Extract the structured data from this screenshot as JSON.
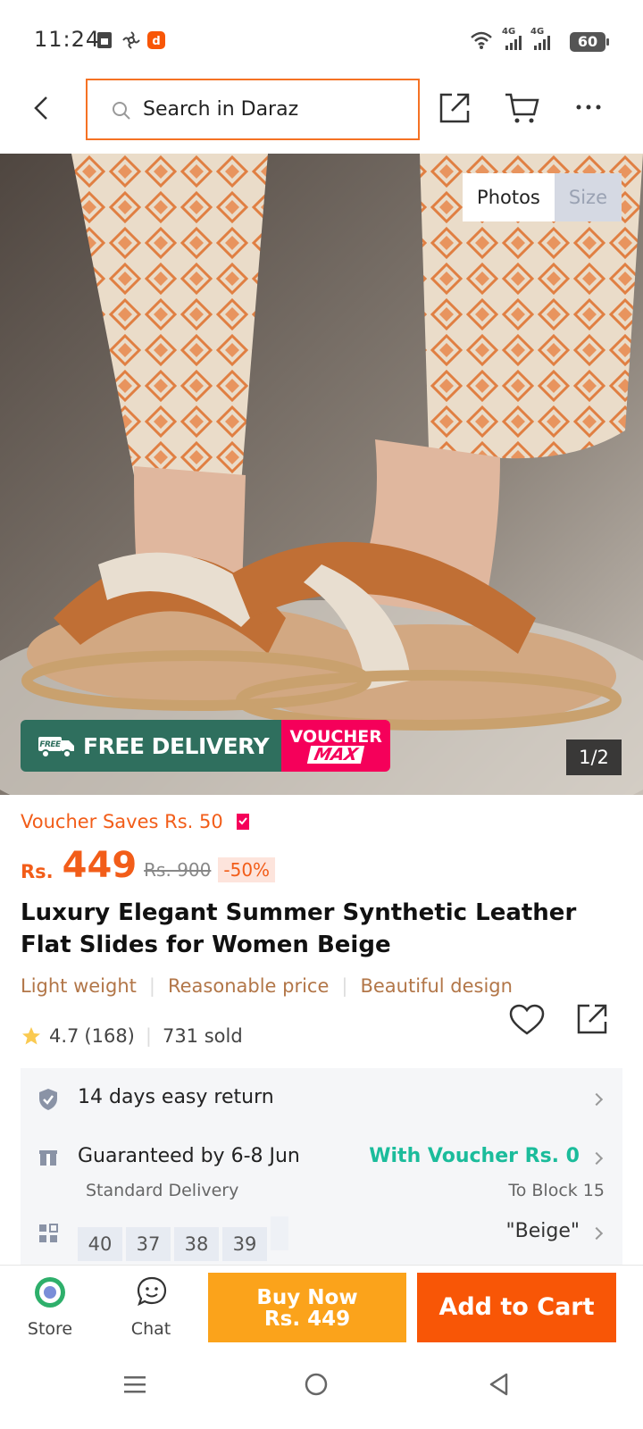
{
  "status_bar": {
    "time": "11:24",
    "network1": "4G",
    "network2": "4G",
    "battery": "60"
  },
  "header": {
    "search_placeholder": "Search in Daraz"
  },
  "gallery": {
    "tabs": [
      "Photos",
      "Size"
    ],
    "active_tab": "Photos",
    "pager": "1/2",
    "promo_free_small": "FREE",
    "promo_free_delivery": "FREE DELIVERY",
    "promo_voucher": "VOUCHER",
    "promo_max": "MAX"
  },
  "product": {
    "voucher_saves": "Voucher Saves Rs. 50",
    "currency": "Rs.",
    "price": "449",
    "original_price": "Rs. 900",
    "discount": "-50%",
    "title": "Luxury Elegant Summer Synthetic Leather Flat Slides for Women Beige",
    "tags": [
      "Light weight",
      "Reasonable price",
      "Beautiful design"
    ],
    "rating": "4.7",
    "rating_count": "(168)",
    "sold": "731 sold"
  },
  "services": {
    "return": "14 days easy return",
    "delivery_guarantee": "Guaranteed by 6-8 Jun",
    "delivery_type": "Standard Delivery",
    "voucher_fee": "With Voucher Rs. 0",
    "location": "To Block 15",
    "sizes": [
      "40",
      "37",
      "38",
      "39"
    ],
    "selected_color": "\"Beige\""
  },
  "bottom_bar": {
    "store_label": "Store",
    "chat_label": "Chat",
    "buy_now_label": "Buy Now",
    "buy_now_price": "Rs. 449",
    "add_to_cart_label": "Add to Cart"
  },
  "colors": {
    "brand_orange": "#f85606",
    "buy_now": "#fba31b",
    "price": "#f25d19",
    "voucher_green": "#1bbc9b"
  }
}
